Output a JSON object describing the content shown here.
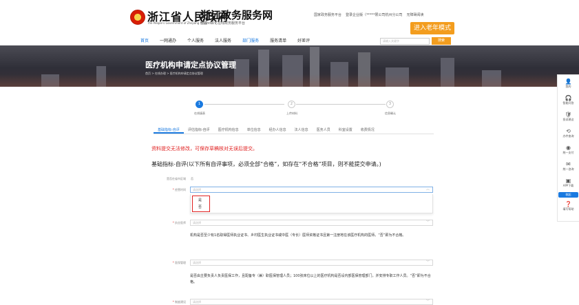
{
  "header": {
    "gov_title": "浙江省人民政府",
    "gov_subtitle": "The People's Government of Zhejiang Province",
    "service_title": "浙江政务服务网",
    "service_subtitle": "全国一体化在线政务服务平台",
    "top_links": [
      "国家政务服务平台",
      "登录企业版（*****限公司杭州分公司",
      "无障碍阅读"
    ],
    "elder_mode_label": "进入老年模式",
    "nav_items": [
      "首页",
      "一网通办",
      "个人服务",
      "法人服务",
      "部门服务",
      "服务清单",
      "好差评"
    ],
    "nav_active_index": 0,
    "search_placeholder": "请输入关键字",
    "search_button": "搜索"
  },
  "banner": {
    "title": "医疗机构申请定点协议管理",
    "breadcrumb": "首页 > 在线办理 > 医疗机构申请定点协议管理"
  },
  "side_panel": {
    "items": [
      {
        "icon": "user-icon",
        "glyph": "👤",
        "label": "我的"
      },
      {
        "icon": "headset-icon",
        "glyph": "🎧",
        "label": "智能问答"
      },
      {
        "icon": "shield-icon",
        "glyph": "🛡",
        "label": "投诉建议"
      },
      {
        "icon": "history-icon",
        "glyph": "⟲",
        "label": "办件查询"
      },
      {
        "icon": "target-icon",
        "glyph": "◉",
        "label": "统一支付"
      },
      {
        "icon": "chat-icon",
        "glyph": "✉",
        "label": "统一咨询"
      },
      {
        "icon": "phone-icon",
        "glyph": "▣",
        "label": "APP下载"
      },
      {
        "icon": "help-icon",
        "glyph": "❓",
        "label": "填写帮助"
      }
    ],
    "badge_label": "收起"
  },
  "steps": {
    "items": [
      {
        "num": "1",
        "label": "在线填表"
      },
      {
        "num": "2",
        "label": "上传材料"
      },
      {
        "num": "3",
        "label": "信息确认"
      }
    ],
    "active_index": 0
  },
  "tabs": {
    "items": [
      "基础指标-自评",
      "评估指标-自评",
      "医疗机构信息",
      "单位信息",
      "经办人信息",
      "法人信息",
      "医务人员",
      "科室设置",
      "收费情况"
    ],
    "active_index": 0
  },
  "warning_text": "资料提交无法修改，可保存草稿核对无误后提交。",
  "section_title": "基础指标-自评(以下所有自评事项，必须全部“合格”，如存在“不合格”项目，则不能提交申请。)",
  "form": {
    "region_label": "是否在省市区域",
    "region_value": "否",
    "select1_label": "经营时间",
    "select1_placeholder": "请选择",
    "dropdown_options": [
      "是",
      "否"
    ],
    "select2_label": "执业医师",
    "select2_placeholder": "请选择",
    "desc2": "机构是否至少有1名取得医师执业证书、乡村医生执业证书或中医（专长）医师资格证书且第一注册地在该医疗机构的医师。“否”即为不合格。",
    "select3_label": "医保管理",
    "select3_placeholder": "请选择",
    "desc3": "是否由主要负责人负责医保工作，且配备专（兼）职医保管理人员；100张床位以上的医疗机构是否设内部医保管理部门，并安排专职工作人员。“否”即为不合格。",
    "select4_label": "制度建设",
    "select4_placeholder": "请选择"
  }
}
